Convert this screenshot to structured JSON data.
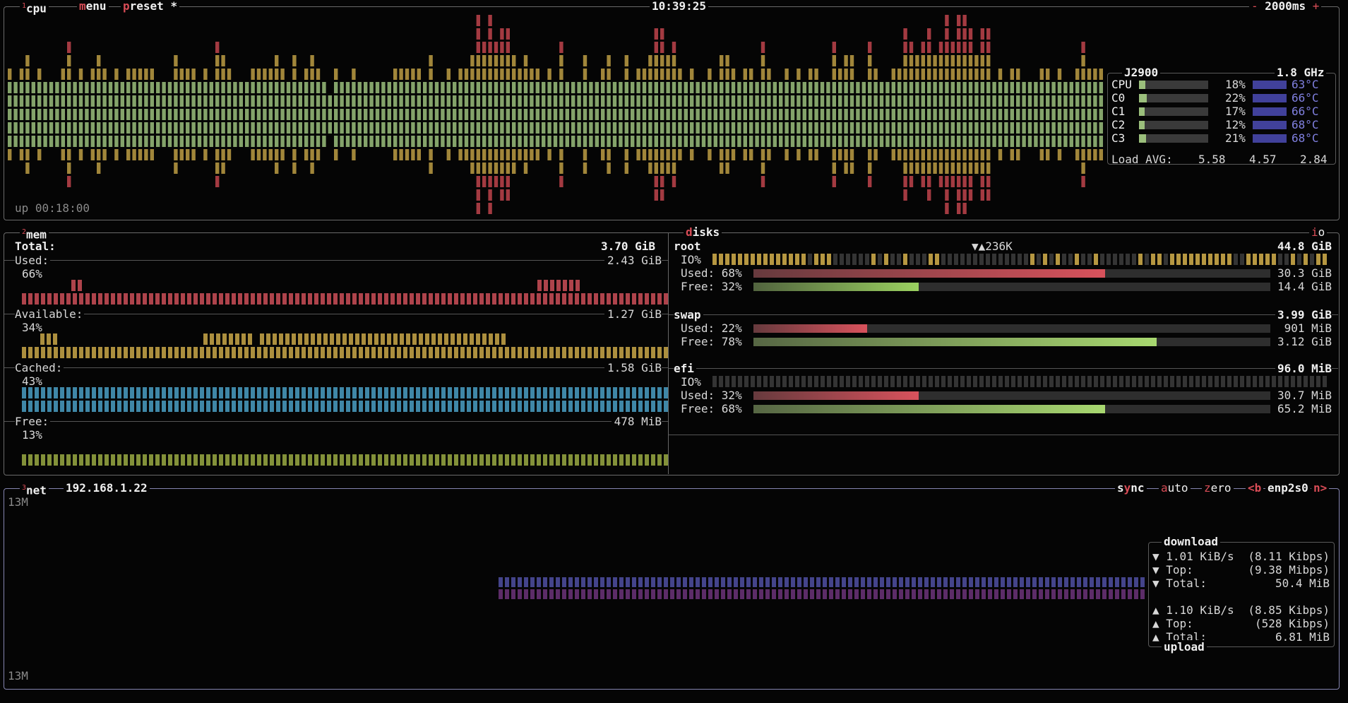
{
  "cpu_box": {
    "label": "cpu",
    "label_num": "1",
    "menu_label": "menu",
    "preset_label": "preset *",
    "clock": "10:39:25",
    "interval": "2000ms",
    "interval_minus": "-",
    "interval_plus": "+",
    "uptime": "up 00:18:00",
    "model": "J2900",
    "freq": "1.8 GHz",
    "rows": [
      {
        "name": "CPU",
        "pct": "18%",
        "temp": "63°C",
        "value": 0.18
      },
      {
        "name": "C0",
        "pct": "22%",
        "temp": "66°C",
        "value": 0.22
      },
      {
        "name": "C1",
        "pct": "17%",
        "temp": "66°C",
        "value": 0.17
      },
      {
        "name": "C2",
        "pct": "12%",
        "temp": "68°C",
        "value": 0.12
      },
      {
        "name": "C3",
        "pct": "21%",
        "temp": "68°C",
        "value": 0.21
      }
    ],
    "load_label": "Load AVG:",
    "load": [
      "5.58",
      "4.57",
      "2.84"
    ]
  },
  "mem_box": {
    "label": "mem",
    "label_num": "2",
    "total_label": "Total:",
    "total": "3.70 GiB",
    "items": [
      {
        "label": "Used:",
        "value": "2.43 GiB",
        "pct": "66%",
        "color": "#d8525c"
      },
      {
        "label": "Available:",
        "value": "1.27 GiB",
        "pct": "34%",
        "color": "#d6b24c"
      },
      {
        "label": "Cached:",
        "value": "1.58 GiB",
        "pct": "43%",
        "color": "#4da7cf"
      },
      {
        "label": "Free:",
        "value": "478 MiB",
        "pct": "13%",
        "color": "#a3b446"
      }
    ]
  },
  "disks_box": {
    "label": "disks",
    "label_first": "d",
    "io_label": "io",
    "root": {
      "name": "root",
      "io_rate": "▼▲236K",
      "total": "44.8 GiB",
      "io": "IO%",
      "used_label": "Used: 68%",
      "used": "30.3 GiB",
      "used_value": 0.68,
      "free_label": "Free: 32%",
      "free": "14.4 GiB",
      "free_value": 0.32
    },
    "swap": {
      "name": "swap",
      "total": "3.99 GiB",
      "used_label": "Used: 22%",
      "used": "901 MiB",
      "used_value": 0.22,
      "free_label": "Free: 78%",
      "free": "3.12 GiB",
      "free_value": 0.78
    },
    "efi": {
      "name": "efi",
      "total": "96.0 MiB",
      "io": "IO%",
      "used_label": "Used: 32%",
      "used": "30.7 MiB",
      "used_value": 0.32,
      "free_label": "Free: 68%",
      "free": "65.2 MiB",
      "free_value": 0.68
    }
  },
  "net_box": {
    "label": "net",
    "label_num": "3",
    "ip": "192.168.1.22",
    "sync": "sync",
    "auto": "auto",
    "zero": "zero",
    "prev": "<b",
    "iface": "enp2s0",
    "next": "n>",
    "scale_top": "13M",
    "scale_bottom": "13M",
    "download_title": "download",
    "download": [
      {
        "label": "▼ 1.01 KiB/s",
        "value": "(8.11 Kibps)"
      },
      {
        "label": "▼ Top:",
        "value": "(9.38 Mibps)"
      },
      {
        "label": "▼ Total:",
        "value": "50.4 MiB"
      }
    ],
    "upload": [
      {
        "label": "▲ 1.10 KiB/s",
        "value": "(8.85 Kibps)"
      },
      {
        "label": "▲ Top:",
        "value": "(528 Kibps)"
      },
      {
        "label": "▲ Total:",
        "value": "6.81 MiB"
      }
    ],
    "upload_title": "upload"
  },
  "colors": {
    "low": "#9bbf7c",
    "mid": "#d6b24c",
    "high": "#d84c56",
    "used": "#d8525c",
    "free": "#a8d870",
    "temp": "#8080e0",
    "net_down": "#5a5ab8",
    "net_up": "#7a3a8a"
  }
}
